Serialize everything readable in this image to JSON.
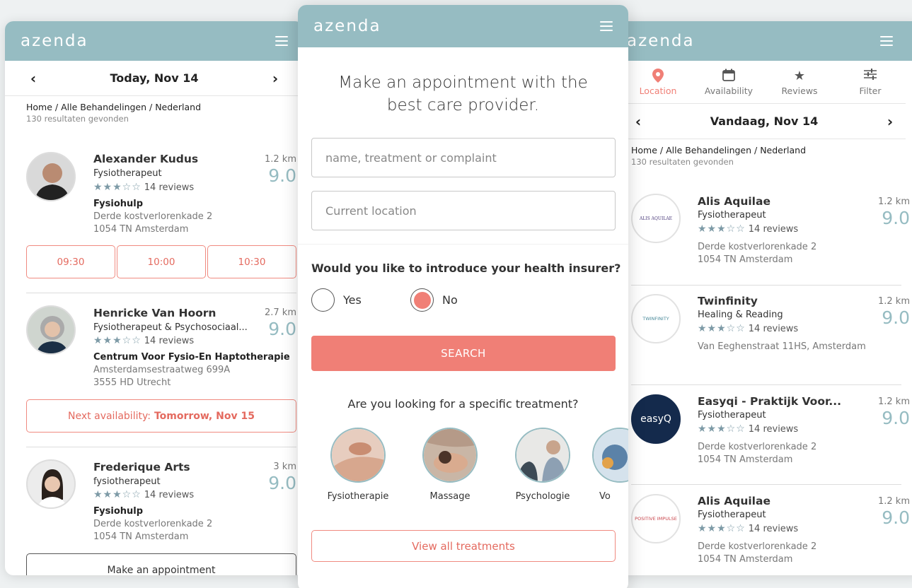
{
  "brand": "azenda",
  "left": {
    "date_title": "Today, Nov 14",
    "breadcrumb": "Home / Alle Behandelingen / Nederland",
    "results": "130 resultaten gevonden",
    "providers": [
      {
        "name": "Alexander Kudus",
        "role": "Fysiotherapeut",
        "reviews": "14 reviews",
        "clinic": "Fysiohulp",
        "addr1": "Derde kostverlorenkade 2",
        "addr2": "1054 TN Amsterdam",
        "distance": "1.2 km",
        "score": "9.0",
        "rating": 3
      },
      {
        "name": "Henricke Van Hoorn",
        "role": "Fysiotherapeut & Psychosociaal...",
        "reviews": "14 reviews",
        "clinic": "Centrum Voor Fysio-En Haptotherapie",
        "addr1": "Amsterdamsestraatweg 699A",
        "addr2": "3555 HD Utrecht",
        "distance": "2.7 km",
        "score": "9.0",
        "rating": 3
      },
      {
        "name": "Frederique Arts",
        "role": "fysiotherapeut",
        "reviews": "14 reviews",
        "clinic": "Fysiohulp",
        "addr1": "Derde kostverlorenkade 2",
        "addr2": "1054 TN Amsterdam",
        "distance": "3 km",
        "score": "9.0",
        "rating": 3
      }
    ],
    "slots": [
      "09:30",
      "10:00",
      "10:30"
    ],
    "next_avail_label": "Next availability:",
    "next_avail_value": "Tomorrow, Nov 15",
    "make_appointment": "Make an appointment"
  },
  "center": {
    "hero": "Make an appointment with the best care provider.",
    "search_placeholder": "name, treatment or complaint",
    "location_placeholder": "Current location",
    "insurer_question": "Would you like to introduce your health insurer?",
    "yes": "Yes",
    "no": "No",
    "selected": "No",
    "search_button": "SEARCH",
    "treatment_question": "Are you looking for a specific treatment?",
    "treatments": [
      "Fysiotherapie",
      "Massage",
      "Psychologie",
      "Vo"
    ],
    "view_all": "View all treatments"
  },
  "right": {
    "tabs": [
      {
        "label": "Location",
        "icon": "location-pin-icon",
        "active": true
      },
      {
        "label": "Availability",
        "icon": "calendar-icon",
        "active": false
      },
      {
        "label": "Reviews",
        "icon": "star-icon",
        "active": false
      },
      {
        "label": "Filter",
        "icon": "filter-sliders-icon",
        "active": false
      }
    ],
    "date_title": "Vandaag, Nov 14",
    "breadcrumb": "Home / Alle Behandelingen / Nederland",
    "results": "130 resultaten gevonden",
    "providers": [
      {
        "name": "Alis Aquilae",
        "role": "Fysiotherapeut",
        "reviews": "14 reviews",
        "addr1": "Derde kostverlorenkade 2",
        "addr2": "1054 TN Amsterdam",
        "distance": "1.2 km",
        "score": "9.0",
        "logo": "ALIS AQUILAE",
        "rating": 3
      },
      {
        "name": "Twinfinity",
        "role": "Healing & Reading",
        "reviews": "14 reviews",
        "addr1": "Van Eeghenstraat 11HS, Amsterdam",
        "addr2": "",
        "distance": "1.2 km",
        "score": "9.0",
        "logo": "TWINFINITY",
        "rating": 3
      },
      {
        "name": "Easyqi - Praktijk Voor...",
        "role": "Fysiotherapeut",
        "reviews": "14 reviews",
        "addr1": "Derde kostverlorenkade 2",
        "addr2": "1054 TN Amsterdam",
        "distance": "1.2 km",
        "score": "9.0",
        "logo": "easyQ",
        "rating": 3
      },
      {
        "name": "Alis Aquilae",
        "role": "Fysiotherapeut",
        "reviews": "14 reviews",
        "addr1": "Derde kostverlorenkade 2",
        "addr2": "1054 TN Amsterdam",
        "distance": "1.2 km",
        "score": "9.0",
        "logo": "POSITIVE IMPULSE",
        "rating": 3
      }
    ]
  },
  "colors": {
    "accent": "#f07f76",
    "brand": "#96bcc2",
    "star": "#7d9aa6"
  }
}
